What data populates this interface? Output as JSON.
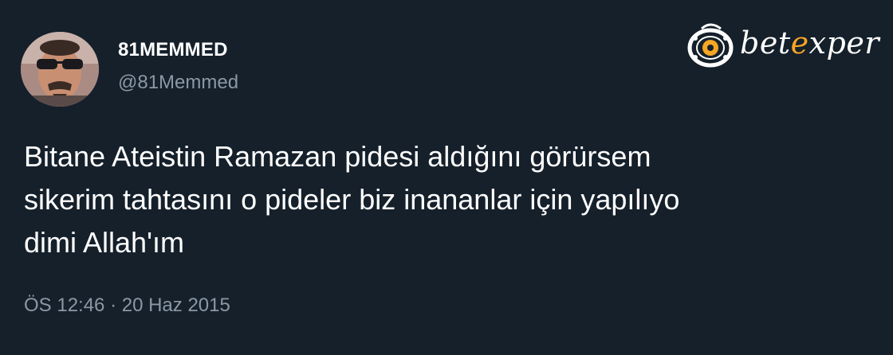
{
  "tweet": {
    "author": {
      "display_name": "81MEMMED",
      "handle": "@81Memmed",
      "avatar": "avatar-photo"
    },
    "text": "Bitane Ateistin Ramazan pidesi aldığını görürsem\nsikerim tahtasını o pideler biz inananlar için yapılıyo\ndimi Allah'ım",
    "timestamp": "ÖS 12:46 · 20 Haz 2015"
  },
  "watermark": {
    "icon": "film-reel-icon",
    "part_a": "bet",
    "part_b": "e",
    "part_c": "xper",
    "colors": {
      "primary": "#ffffff",
      "accent": "#f5a623"
    }
  },
  "theme": {
    "background": "#15202b",
    "text": "#ffffff",
    "muted": "#8b98a5"
  }
}
